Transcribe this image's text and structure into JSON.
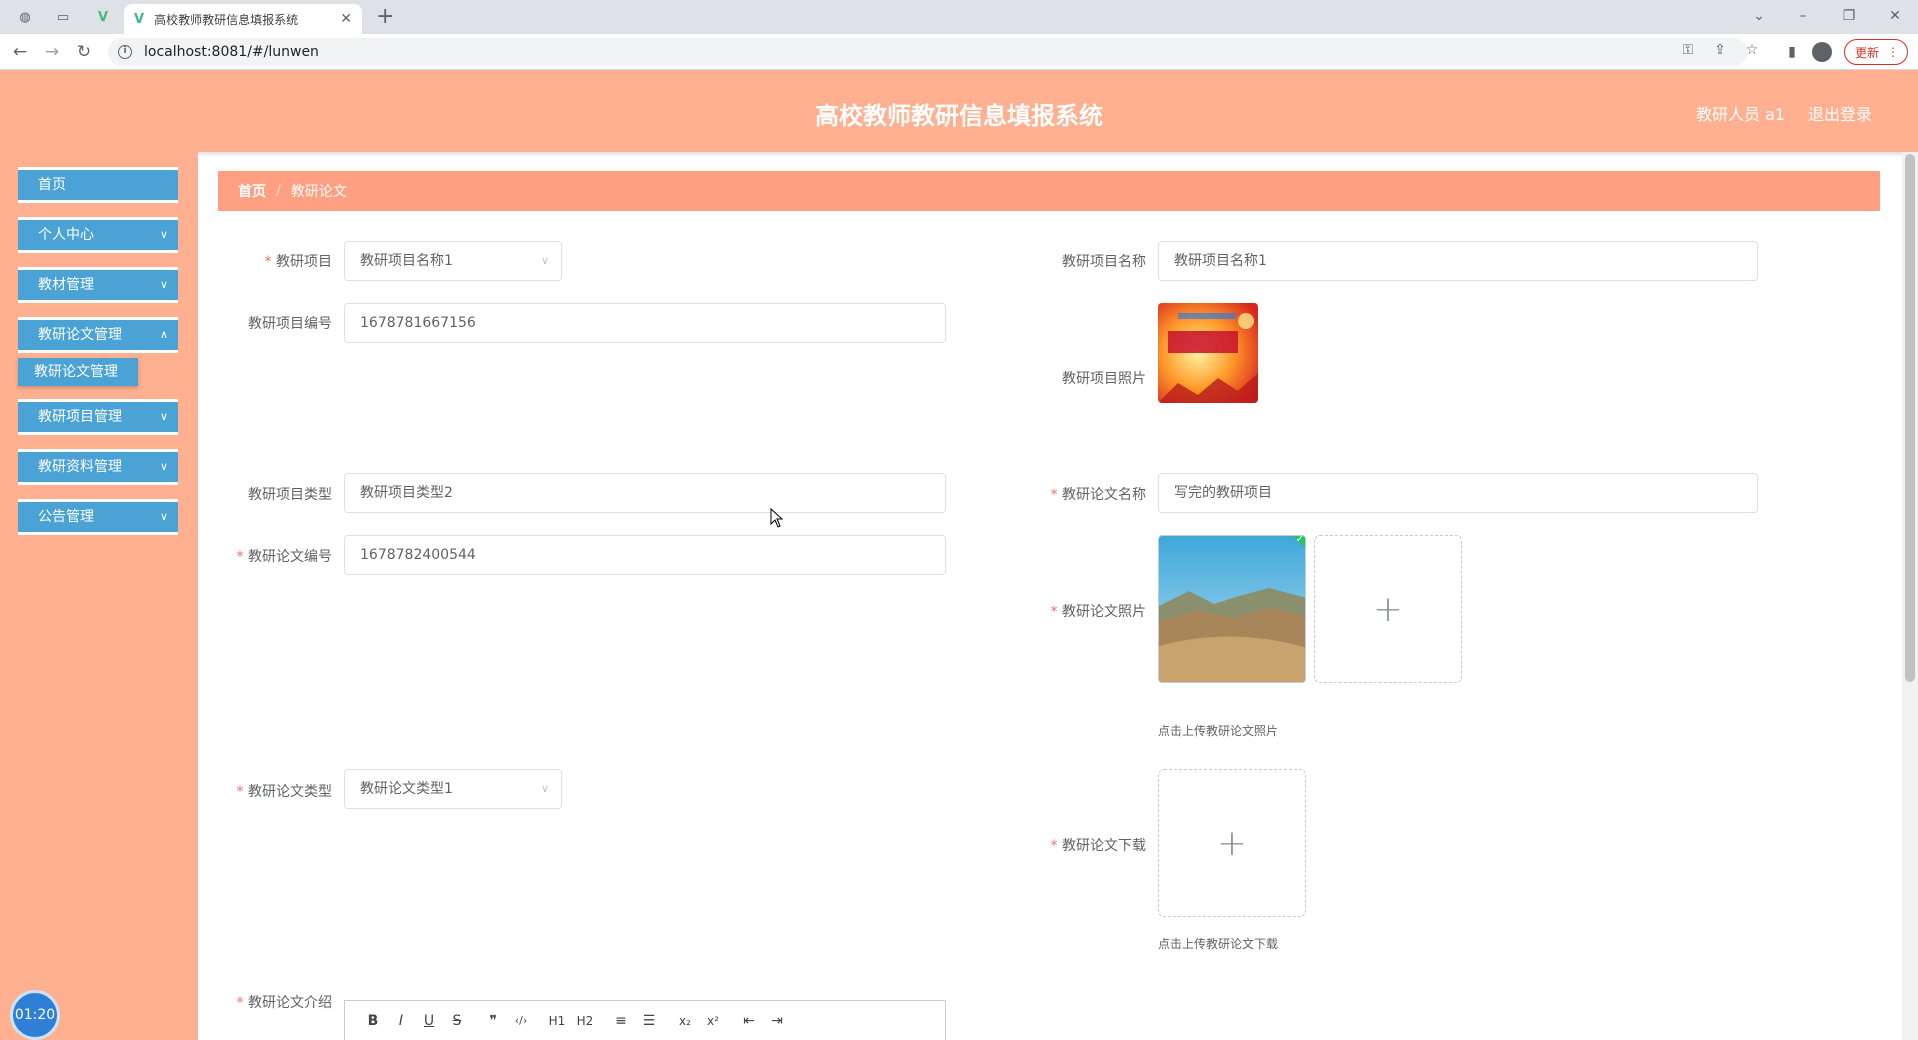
{
  "browser": {
    "tab_title": "高校教师教研信息填报系统",
    "url": "localhost:8081/#/lunwen",
    "update_label": "更新"
  },
  "header": {
    "title": "高校教师教研信息填报系统",
    "user": "教研人员 a1",
    "logout": "退出登录"
  },
  "sidebar": {
    "items": [
      {
        "label": "首页"
      },
      {
        "label": "个人中心"
      },
      {
        "label": "教材管理"
      },
      {
        "label": "教研论文管理"
      },
      {
        "label": "教研项目管理"
      },
      {
        "label": "教研资料管理"
      },
      {
        "label": "公告管理"
      }
    ],
    "sub_item": "教研论文管理",
    "clock": "01:20"
  },
  "breadcrumb": {
    "home": "首页",
    "current": "教研论文"
  },
  "form": {
    "project_label": "教研项目",
    "project_value": "教研项目名称1",
    "project_name_label": "教研项目名称",
    "project_name_value": "教研项目名称1",
    "project_no_label": "教研项目编号",
    "project_no_value": "1678781667156",
    "project_photo_label": "教研项目照片",
    "project_type_label": "教研项目类型",
    "project_type_value": "教研项目类型2",
    "paper_name_label": "教研论文名称",
    "paper_name_value": "写完的教研项目",
    "paper_no_label": "教研论文编号",
    "paper_no_value": "1678782400544",
    "paper_photo_label": "教研论文照片",
    "paper_photo_hint": "点击上传教研论文照片",
    "paper_type_label": "教研论文类型",
    "paper_type_value": "教研论文类型1",
    "paper_download_label": "教研论文下载",
    "paper_download_hint": "点击上传教研论文下载",
    "paper_intro_label": "教研论文介绍"
  },
  "editor_toolbar": [
    "B",
    "I",
    "U",
    "S",
    "❞",
    "‹/›",
    "H1",
    "H2",
    "≡",
    "☰",
    "x₂",
    "x²",
    "⇤",
    "⇥"
  ]
}
